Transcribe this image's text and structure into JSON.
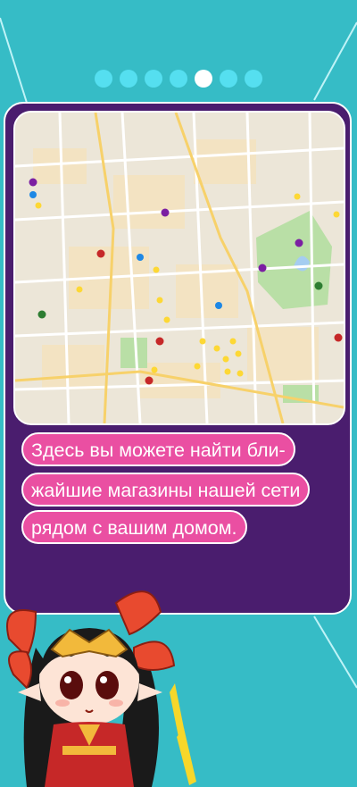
{
  "pagination": {
    "total": 7,
    "active_index": 4
  },
  "map": {
    "alt": "map of nearby stores"
  },
  "description": {
    "lines": [
      "Здесь вы можете найти бли-",
      "жайшие магазины нашей сети",
      "рядом с вашим домом."
    ]
  },
  "colors": {
    "background": "#36bcc6",
    "card": "#4a1d6e",
    "pill": "#ea4fa2",
    "dot_inactive": "#55dff0",
    "dot_active": "#ffffff"
  },
  "icons": {
    "map_markers": [
      "store-pin-icon",
      "metro-icon",
      "poi-icon"
    ],
    "mascot": "mascot-character"
  }
}
